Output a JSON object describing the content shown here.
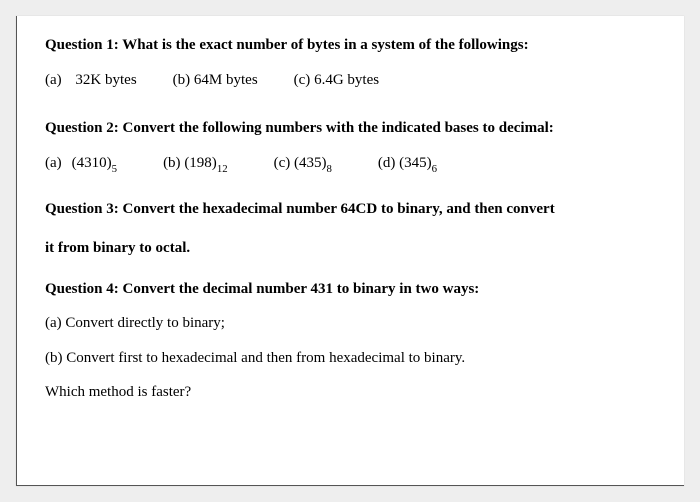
{
  "q1": {
    "header": "Question 1: What is the exact number of bytes in a system of the followings:",
    "opts": {
      "a_label": "(a)",
      "a_text": "32K bytes",
      "b_label": "(b)",
      "b_text": "64M bytes",
      "c_label": "(c)",
      "c_text": "6.4G bytes"
    }
  },
  "q2": {
    "header": "Question 2: Convert the following numbers with the indicated bases to decimal:",
    "opts": {
      "a_label": "(a)",
      "a_num": "(4310)",
      "a_base": "5",
      "b_label": "(b)",
      "b_num": "(198)",
      "b_base": "12",
      "c_label": "(c)",
      "c_num": "(435)",
      "c_base": "8",
      "d_label": "(d)",
      "d_num": "(345)",
      "d_base": "6"
    }
  },
  "q3": {
    "line1": "Question 3: Convert the hexadecimal number 64CD to binary, and then convert",
    "line2": "it from binary to octal."
  },
  "q4": {
    "header": "Question 4: Convert the decimal number 431 to binary in two ways:",
    "a": "(a) Convert directly to binary;",
    "b": "(b) Convert first to hexadecimal and then from hexadecimal to binary.",
    "footer": "Which method is faster?"
  }
}
